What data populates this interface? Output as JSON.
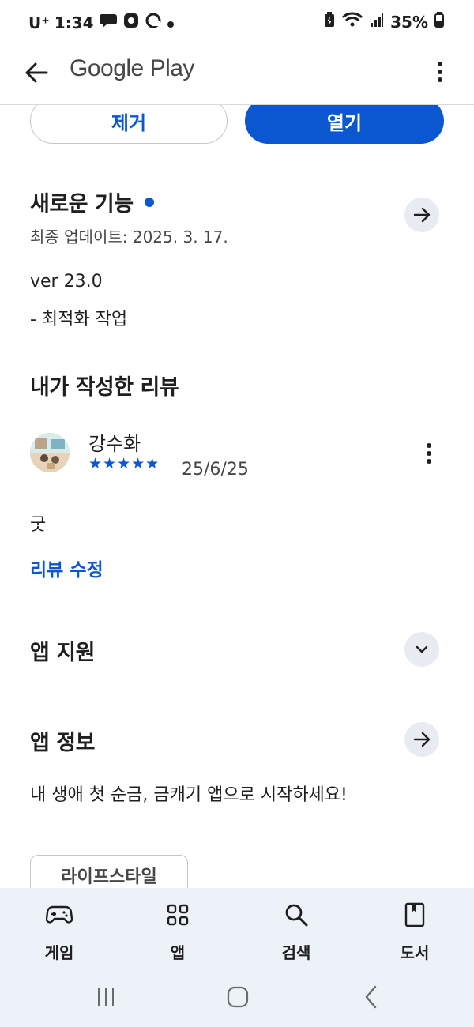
{
  "status_bar": {
    "carrier": "U⁺",
    "time": "1:34",
    "battery": "35%"
  },
  "app_bar": {
    "title": "Google Play"
  },
  "actions": {
    "remove_label": "제거",
    "open_label": "열기"
  },
  "whats_new": {
    "title": "새로운 기능",
    "updated": "최종 업데이트: 2025. 3. 17.",
    "version": "ver 23.0",
    "notes": "- 최적화 작업"
  },
  "my_review": {
    "title": "내가 작성한 리뷰",
    "author": "강수화",
    "stars": "★★★★★",
    "rating": 5,
    "date": "25/6/25",
    "text": "굿",
    "edit_label": "리뷰 수정"
  },
  "app_support": {
    "title": "앱 지원"
  },
  "app_info": {
    "title": "앱 정보",
    "description": "내 생애 첫 순금, 금캐기 앱으로 시작하세요!",
    "category_chip": "라이프스타일"
  },
  "bottom_nav": {
    "items": [
      {
        "label": "게임",
        "icon": "gamepad-icon"
      },
      {
        "label": "앱",
        "icon": "apps-grid-icon"
      },
      {
        "label": "검색",
        "icon": "search-icon"
      },
      {
        "label": "도서",
        "icon": "book-icon"
      }
    ]
  },
  "colors": {
    "accent": "#0b57d0",
    "nav_bg": "#edf1f8",
    "round_btn_bg": "#e8ebf2"
  }
}
